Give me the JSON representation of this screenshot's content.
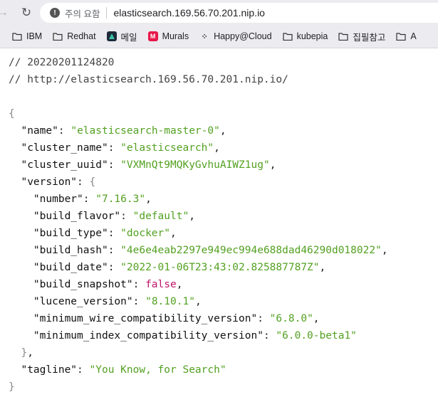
{
  "browser": {
    "security_text": "주의 요함",
    "url": "elasticsearch.169.56.70.201.nip.io",
    "bookmarks": [
      {
        "label": "IBM"
      },
      {
        "label": "Redhat"
      },
      {
        "label": "메일"
      },
      {
        "label": "Murals"
      },
      {
        "label": "Happy@Cloud"
      },
      {
        "label": "kubepia"
      },
      {
        "label": "집필참고"
      },
      {
        "label": "A"
      }
    ]
  },
  "json_view": {
    "comment_timestamp": "// 20220201124820",
    "comment_url": "// http://elasticsearch.169.56.70.201.nip.io/",
    "name": "elasticsearch-master-0",
    "cluster_name": "elasticsearch",
    "cluster_uuid": "VXMnQt9MQKyGvhuAIWZ1ug",
    "version": {
      "number": "7.16.3",
      "build_flavor": "default",
      "build_type": "docker",
      "build_hash": "4e6e4eab2297e949ec994e688dad46290d018022",
      "build_date": "2022-01-06T23:43:02.825887787Z",
      "build_snapshot": "false",
      "lucene_version": "8.10.1",
      "minimum_wire_compatibility_version": "6.8.0",
      "minimum_index_compatibility_version": "6.0.0-beta1"
    },
    "tagline": "You Know, for Search"
  }
}
